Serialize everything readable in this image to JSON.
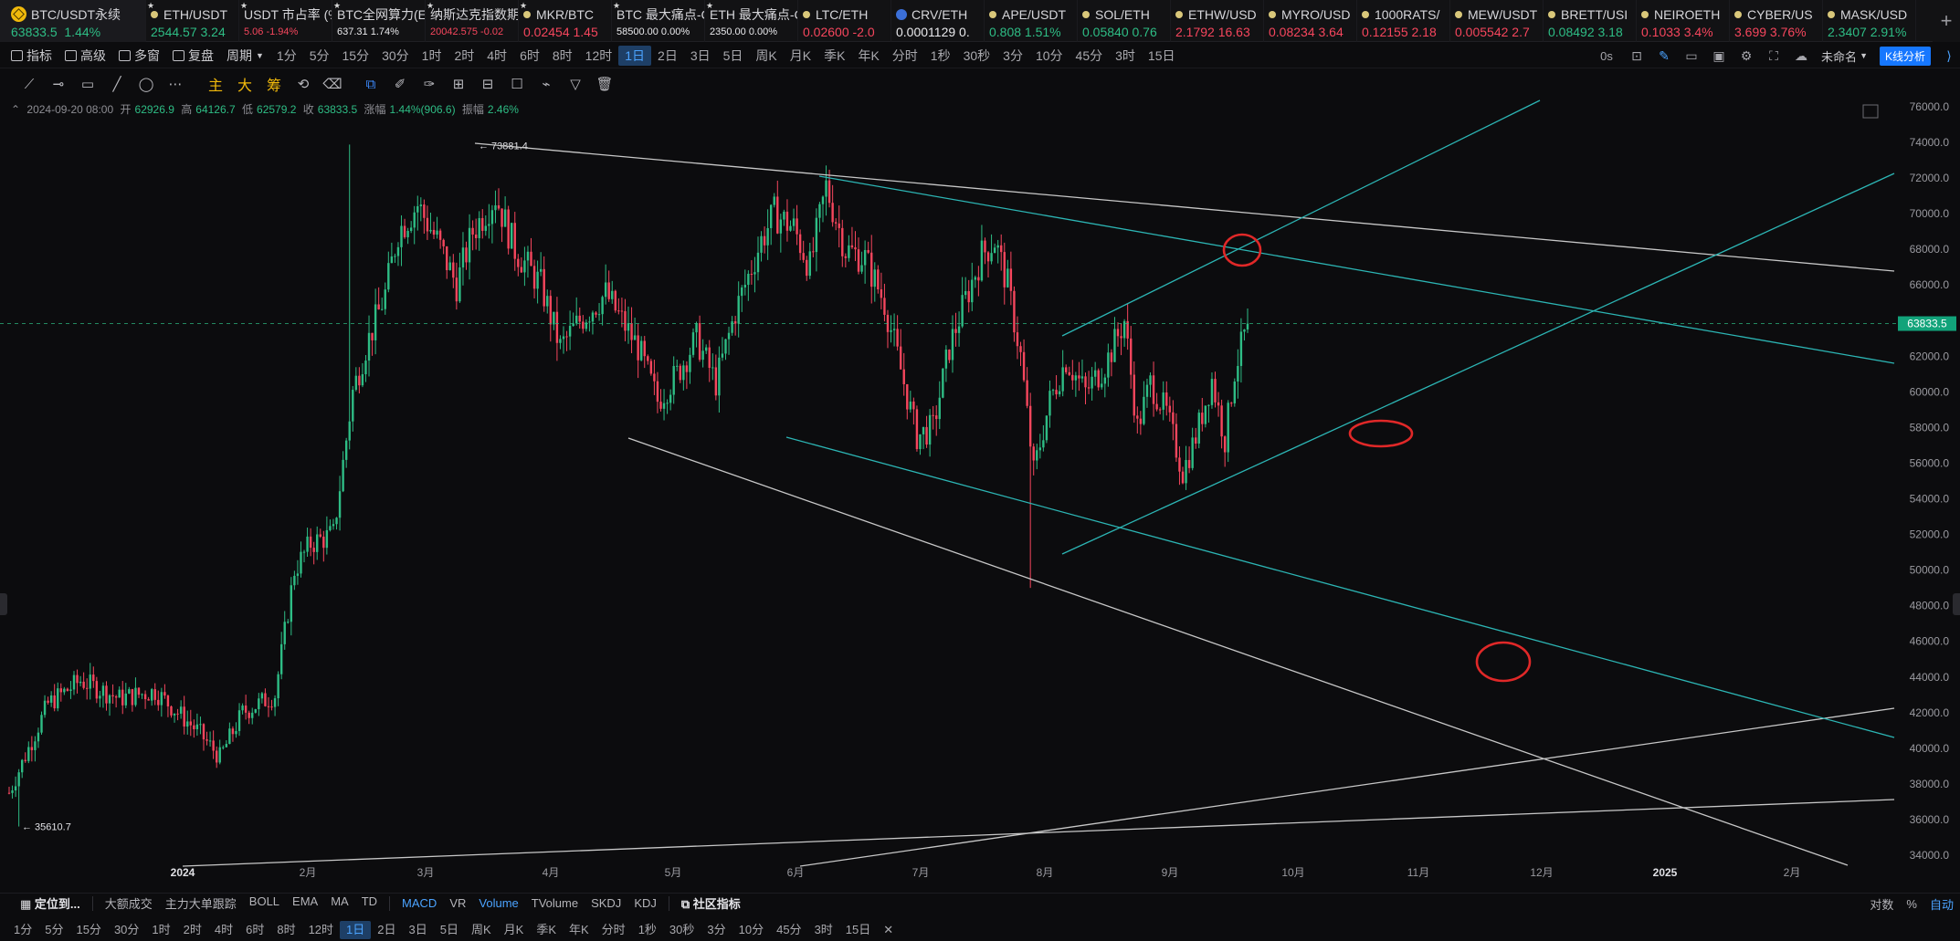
{
  "ticker": {
    "main": {
      "name": "BTC/USDT永续",
      "price": "63833.5",
      "change": "1.44%"
    },
    "items": [
      {
        "name": "ETH/USDT",
        "line2": "2544.57  3.24",
        "dir": "up",
        "star": true,
        "dot": true
      },
      {
        "name": "USDT 市占率 (%",
        "line2": "5.06  -1.94%",
        "dir": "dn",
        "star": true,
        "small": true
      },
      {
        "name": "BTC全网算力(EF",
        "line2": "637.31  1.74%",
        "dir": "wh",
        "star": true,
        "small": true
      },
      {
        "name": "纳斯达克指数期",
        "line2": "20042.575  -0.02",
        "dir": "dn",
        "star": true,
        "small": true
      },
      {
        "name": "MKR/BTC",
        "line2": "0.02454  1.45",
        "dir": "dn",
        "star": true,
        "dot": true
      },
      {
        "name": "BTC 最大痛点-C",
        "line2": "58500.00  0.00%",
        "dir": "wh",
        "star": true,
        "small": true
      },
      {
        "name": "ETH 最大痛点-C",
        "line2": "2350.00  0.00%",
        "dir": "wh",
        "star": true,
        "small": true
      },
      {
        "name": "LTC/ETH",
        "line2": "0.02600  -2.0",
        "dir": "dn",
        "dot": true
      },
      {
        "name": "CRV/ETH",
        "line2": "0.0001129  0.",
        "dir": "wh",
        "crv": true
      },
      {
        "name": "APE/USDT",
        "line2": "0.808  1.51%",
        "dir": "up",
        "dot": true
      },
      {
        "name": "SOL/ETH",
        "line2": "0.05840  0.76",
        "dir": "up",
        "dot": true
      },
      {
        "name": "ETHW/USD",
        "line2": "2.1792  16.63",
        "dir": "dn",
        "dot": true
      },
      {
        "name": "MYRO/USD",
        "line2": "0.08234  3.64",
        "dir": "dn",
        "dot": true
      },
      {
        "name": "1000RATS/",
        "line2": "0.12155  2.18",
        "dir": "dn",
        "dot": true
      },
      {
        "name": "MEW/USDT",
        "line2": "0.005542  2.7",
        "dir": "dn",
        "dot": true
      },
      {
        "name": "BRETT/USI",
        "line2": "0.08492  3.18",
        "dir": "up",
        "dot": true
      },
      {
        "name": "NEIROETH",
        "line2": "0.1033  3.4%",
        "dir": "dn",
        "dot": true
      },
      {
        "name": "CYBER/US",
        "line2": "3.699  3.76%",
        "dir": "dn",
        "dot": true
      },
      {
        "name": "MASK/USD",
        "line2": "2.3407  2.91%",
        "dir": "up",
        "dot": true
      }
    ],
    "add": "+"
  },
  "toolbar": {
    "indicator": "指标",
    "advanced": "高级",
    "multi": "多窗",
    "replay": "复盘",
    "period": "周期",
    "timeframes": [
      "1分",
      "5分",
      "15分",
      "30分",
      "1时",
      "2时",
      "4时",
      "6时",
      "8时",
      "12时",
      "1日",
      "2日",
      "3日",
      "5日",
      "周K",
      "月K",
      "季K",
      "年K",
      "分时",
      "1秒",
      "30秒",
      "3分",
      "10分",
      "45分",
      "3时",
      "15日"
    ],
    "active_timeframe": "1日",
    "countdown": "0s",
    "unnamed": "未命名",
    "kline_analysis": "K线分析"
  },
  "drawing_tools": {
    "main": "主",
    "big": "大",
    "chip": "筹"
  },
  "info_line": {
    "datetime": "2024-09-20 08:00",
    "open_label": "开",
    "open": "62926.9",
    "high_label": "高",
    "high": "64126.7",
    "low_label": "低",
    "low": "62579.2",
    "close_label": "收",
    "close": "63833.5",
    "change_label": "涨幅",
    "change": "1.44%(906.6)",
    "amp_label": "振幅",
    "amp": "2.46%"
  },
  "chart_data": {
    "type": "candlestick",
    "symbol": "BTC/USDT永续",
    "y_ticks": [
      "76000.0",
      "74000.0",
      "72000.0",
      "70000.0",
      "68000.0",
      "66000.0",
      "64000.0",
      "62000.0",
      "60000.0",
      "58000.0",
      "56000.0",
      "54000.0",
      "52000.0",
      "50000.0",
      "48000.0",
      "46000.0",
      "44000.0",
      "42000.0",
      "40000.0",
      "38000.0",
      "36000.0",
      "34000.0"
    ],
    "x_ticks": [
      "2024",
      "2月",
      "3月",
      "4月",
      "5月",
      "6月",
      "7月",
      "8月",
      "9月",
      "10月",
      "11月",
      "12月",
      "2025",
      "2月"
    ],
    "ylim": [
      33500,
      76000
    ],
    "last_price": "63833.5",
    "high_marker": "73881.4",
    "low_marker": "35610.7",
    "closes_anchor": [
      [
        0,
        37500
      ],
      [
        12,
        42500
      ],
      [
        22,
        43800
      ],
      [
        34,
        42800
      ],
      [
        45,
        43200
      ],
      [
        58,
        41000
      ],
      [
        65,
        39500
      ],
      [
        72,
        42000
      ],
      [
        82,
        43000
      ],
      [
        88,
        50000
      ],
      [
        93,
        51500
      ],
      [
        100,
        52000
      ],
      [
        106,
        60000
      ],
      [
        110,
        62500
      ],
      [
        116,
        65500
      ],
      [
        120,
        69000
      ],
      [
        126,
        70500
      ],
      [
        132,
        68500
      ],
      [
        138,
        66000
      ],
      [
        143,
        69000
      ],
      [
        150,
        71000
      ],
      [
        156,
        68000
      ],
      [
        164,
        66000
      ],
      [
        170,
        62500
      ],
      [
        176,
        64000
      ],
      [
        184,
        65500
      ],
      [
        194,
        62500
      ],
      [
        200,
        59500
      ],
      [
        206,
        61000
      ],
      [
        212,
        63000
      ],
      [
        218,
        60500
      ],
      [
        224,
        64500
      ],
      [
        232,
        68500
      ],
      [
        236,
        70000
      ],
      [
        242,
        69200
      ],
      [
        247,
        67000
      ],
      [
        252,
        71500
      ],
      [
        258,
        68000
      ],
      [
        264,
        67500
      ],
      [
        270,
        65000
      ],
      [
        276,
        60500
      ],
      [
        280,
        57500
      ],
      [
        285,
        58000
      ],
      [
        290,
        62500
      ],
      [
        295,
        65200
      ],
      [
        300,
        67700
      ],
      [
        304,
        68500
      ],
      [
        308,
        66000
      ],
      [
        312,
        62000
      ],
      [
        316,
        55500
      ],
      [
        321,
        59500
      ],
      [
        326,
        61800
      ],
      [
        332,
        60000
      ],
      [
        338,
        61500
      ],
      [
        344,
        64000
      ],
      [
        348,
        58000
      ],
      [
        352,
        60500
      ],
      [
        357,
        58800
      ],
      [
        362,
        55500
      ],
      [
        366,
        57500
      ],
      [
        371,
        60700
      ],
      [
        375,
        57300
      ],
      [
        378,
        61200
      ],
      [
        382,
        63800
      ]
    ],
    "overlay_labels": [],
    "annotations": "three red ellipses on trendline intersections"
  },
  "bottom": {
    "locate": "定位到...",
    "indicators": [
      "大额成交",
      "主力大单跟踪",
      "BOLL",
      "EMA",
      "MA",
      "TD"
    ],
    "sub_indicators": [
      "MACD",
      "VR",
      "Volume",
      "TVolume",
      "SKDJ",
      "KDJ"
    ],
    "active_sub": [
      "MACD",
      "Volume"
    ],
    "community": "社区指标",
    "right": {
      "log": "对数",
      "pct": "%",
      "auto": "自动"
    }
  },
  "colors": {
    "up": "#2ebd85",
    "down": "#f6465d",
    "accent": "#4ba3ff",
    "teal": "#2cb5b4",
    "trend": "#c8c8c8",
    "mark": "#e02828"
  }
}
